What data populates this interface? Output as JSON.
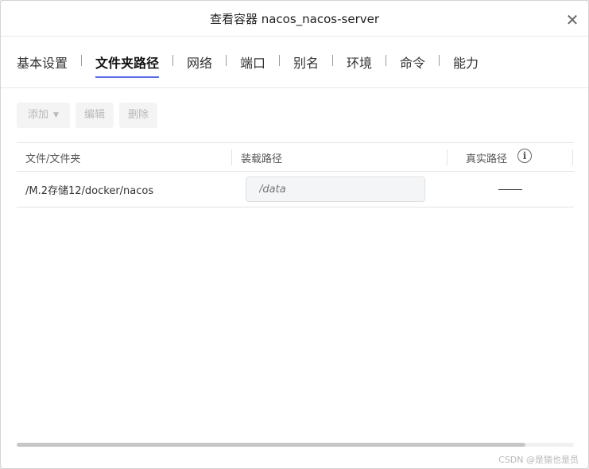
{
  "dialog": {
    "title": "查看容器 nacos_nacos-server",
    "close_symbol": "✕"
  },
  "tabs": [
    {
      "label": "基本设置",
      "active": false
    },
    {
      "label": "文件夹路径",
      "active": true
    },
    {
      "label": "网络",
      "active": false
    },
    {
      "label": "端口",
      "active": false
    },
    {
      "label": "别名",
      "active": false
    },
    {
      "label": "环境",
      "active": false
    },
    {
      "label": "命令",
      "active": false
    },
    {
      "label": "能力",
      "active": false
    }
  ],
  "toolbar": {
    "add_label": "添加",
    "edit_label": "编辑",
    "delete_label": "删除"
  },
  "table": {
    "columns": [
      "文件/文件夹",
      "装载路径",
      "真实路径"
    ],
    "info_symbol": "i",
    "rows": [
      {
        "file": "/M.2存储12/docker/nacos",
        "mount_placeholder": "/data",
        "real_path": "——"
      }
    ]
  },
  "watermark": "CSDN @是猿也是员",
  "colors": {
    "accent": "#5b6ee8",
    "disabled_text": "#b8b8b8"
  }
}
